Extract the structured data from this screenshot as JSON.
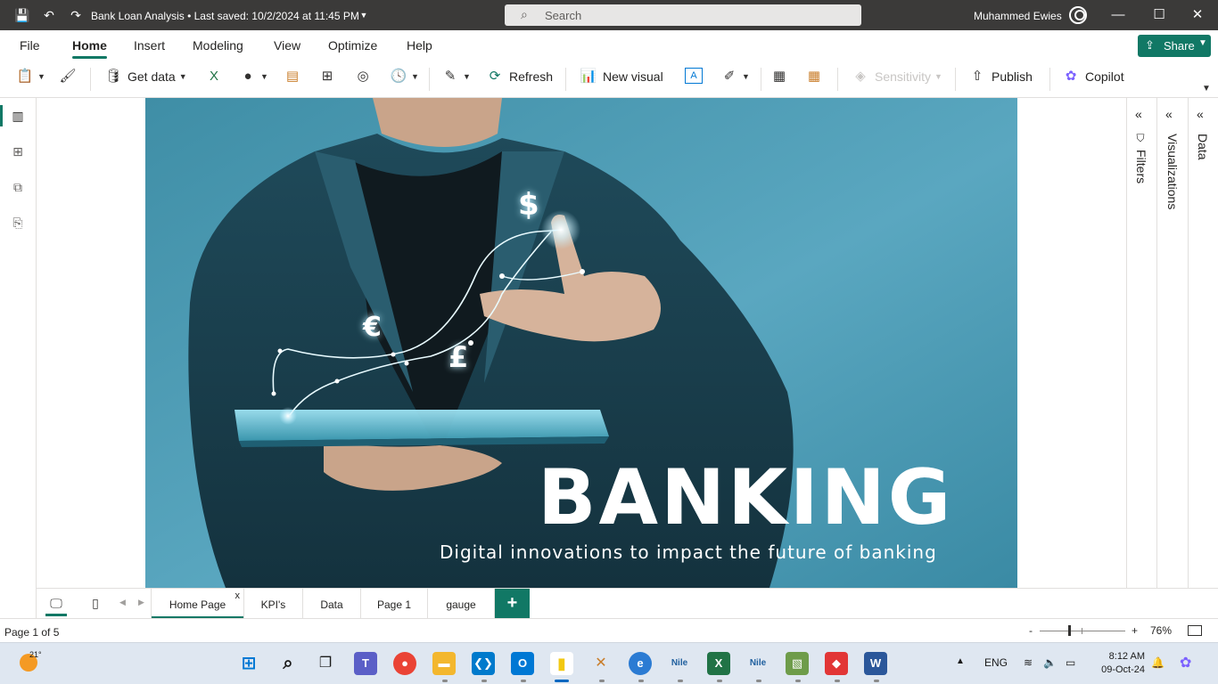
{
  "window": {
    "title": "Bank Loan Analysis • Last saved: 10/2/2024 at 11:45 PM",
    "search_label": "Search",
    "user_name": "Muhammed Ewies"
  },
  "ribbon": {
    "tabs": [
      {
        "label": "File"
      },
      {
        "label": "Home",
        "active": true
      },
      {
        "label": "Insert"
      },
      {
        "label": "Modeling"
      },
      {
        "label": "View"
      },
      {
        "label": "Optimize"
      },
      {
        "label": "Help"
      }
    ],
    "share_label": "Share"
  },
  "toolbar": {
    "get_data": "Get data",
    "refresh": "Refresh",
    "new_visual": "New visual",
    "sensitivity": "Sensitivity",
    "publish": "Publish",
    "copilot": "Copilot"
  },
  "canvas": {
    "headline": "BANKING",
    "subline": "Digital innovations to impact the future of banking",
    "symbols": {
      "dollar": "$",
      "euro": "€",
      "pound": "£"
    }
  },
  "panes": {
    "filters": "Filters",
    "visualizations": "Visualizations",
    "data": "Data"
  },
  "pages": [
    {
      "label": "Home Page",
      "active": true,
      "close": "x"
    },
    {
      "label": "KPI's"
    },
    {
      "label": "Data"
    },
    {
      "label": "Page 1"
    },
    {
      "label": "gauge"
    }
  ],
  "add_page": "+",
  "status": {
    "page_info": "Page 1 of 5",
    "zoom_minus": "-",
    "zoom_plus": "+",
    "zoom_value": "76%"
  },
  "taskbar": {
    "temperature": "21°",
    "language": "ENG",
    "time": "8:12 AM",
    "date": "09-Oct-24"
  },
  "colors": {
    "accent": "#117865",
    "titlebar": "#3b3a39",
    "hero_bg": "#4f9db5"
  }
}
